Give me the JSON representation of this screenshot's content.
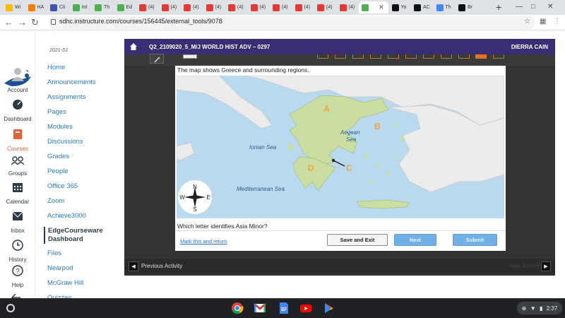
{
  "browser": {
    "tabs": [
      {
        "label": "Wi",
        "color": "#fbbc04"
      },
      {
        "label": "HA",
        "color": "#f57c00"
      },
      {
        "label": "Cli",
        "color": "#3f51b5"
      },
      {
        "label": "Int",
        "color": "#4caf50"
      },
      {
        "label": "Th",
        "color": "#4caf50"
      },
      {
        "label": "Ed",
        "color": "#4caf50"
      },
      {
        "label": "(4)",
        "color": "#e53935"
      },
      {
        "label": "(4)",
        "color": "#e53935"
      },
      {
        "label": "(4)",
        "color": "#e53935"
      },
      {
        "label": "(4)",
        "color": "#e53935"
      },
      {
        "label": "(4)",
        "color": "#e53935"
      },
      {
        "label": "(4)",
        "color": "#e53935"
      },
      {
        "label": "(4)",
        "color": "#e53935"
      },
      {
        "label": "(4)",
        "color": "#e53935"
      },
      {
        "label": "(4)",
        "color": "#e53935"
      },
      {
        "label": "(4)",
        "color": "#e53935"
      },
      {
        "label": "",
        "color": "#4caf50",
        "active": true
      },
      {
        "label": "Yo",
        "color": "#111111"
      },
      {
        "label": "AC",
        "color": "#111111"
      },
      {
        "label": "Th",
        "color": "#4285f4"
      },
      {
        "label": "Br",
        "color": "#111111"
      }
    ],
    "url": "sdhc.instructure.com/courses/156445/external_tools/9078"
  },
  "global_nav": {
    "items": [
      {
        "label": "Account",
        "icon": "account-icon"
      },
      {
        "label": "Dashboard",
        "icon": "dashboard-icon"
      },
      {
        "label": "Courses",
        "icon": "courses-icon"
      },
      {
        "label": "Groups",
        "icon": "groups-icon"
      },
      {
        "label": "Calendar",
        "icon": "calendar-icon"
      },
      {
        "label": "Inbox",
        "icon": "inbox-icon"
      },
      {
        "label": "History",
        "icon": "history-icon"
      },
      {
        "label": "Help",
        "icon": "help-icon"
      }
    ]
  },
  "course_nav": {
    "term": "2021-S1",
    "items": [
      "Home",
      "Announcements",
      "Assignments",
      "Pages",
      "Modules",
      "Discussions",
      "Grades",
      "People",
      "Office 365",
      "Zoom",
      "Achieve3000",
      "EdgeCourseware Dashboard",
      "Files",
      "Nearpod",
      "McGraw Hill",
      "Quizzes"
    ],
    "active_index": 11,
    "active_line1": "EdgeCourseware",
    "active_line2": "Dashboard"
  },
  "edgenuity": {
    "course_title": "Q2_2109020_5_M/J WORLD HIST ADV – 0297",
    "user_name": "DIERRA CAIN",
    "question": {
      "prompt": "The map shows Greece and surrounding regions.",
      "text": "Which letter identifies Asia Minor?"
    },
    "map": {
      "labels": {
        "ionian_sea": "Ionian Sea",
        "aegean_sea_1": "Aegean",
        "aegean_sea_2": "Sea",
        "mediterranean_sea": "Mediterranean Sea",
        "letter_a": "A",
        "letter_b": "B",
        "letter_c": "C",
        "letter_d": "D"
      },
      "compass": {
        "n": "N",
        "s": "S",
        "e": "E",
        "w": "W"
      },
      "colors": {
        "sea": "#b9d9ef",
        "land_highlight": "#c9dea0",
        "land": "#ececec",
        "letter": "#f0a23a"
      }
    },
    "mark_link": "Mark this and return",
    "buttons": {
      "save_exit": "Save and Exit",
      "next": "Next",
      "submit": "Submit"
    },
    "footer": {
      "prev": "Previous Activity",
      "next": "Next Activity"
    }
  },
  "shelf": {
    "apps": [
      "chrome-icon",
      "gmail-icon",
      "docs-icon",
      "youtube-icon",
      "play-store-icon"
    ],
    "time": "2:37"
  }
}
